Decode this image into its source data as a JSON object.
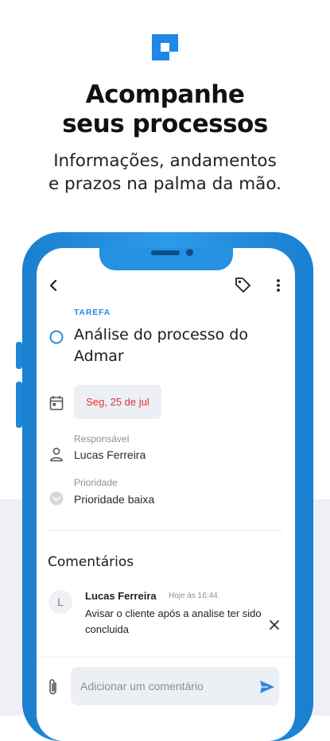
{
  "promo": {
    "headline_line1": "Acompanhe",
    "headline_line2": "seus processos",
    "subline_line1": "Informações, andamentos",
    "subline_line2": "e prazos na palma da mão.",
    "brand_color": "#1e88e5"
  },
  "app": {
    "header": {
      "back_icon": "chevron-left-icon",
      "tag_icon": "tag-icon",
      "more_icon": "more-vertical-icon"
    },
    "task": {
      "kind": "TAREFA",
      "title": "Análise do processo do Admar",
      "due_date": "Seg, 25 de jul",
      "due_date_color": "#e03232",
      "responsible_label": "Responsável",
      "responsible_value": "Lucas Ferreira",
      "priority_label": "Prioridade",
      "priority_value": "Prioridade baixa"
    },
    "comments": {
      "heading": "Comentários",
      "items": [
        {
          "avatar_initial": "L",
          "author": "Lucas Ferreira",
          "time": "Hoje às 16:44",
          "text": "Avisar o cliente após a analise ter sido concluida"
        }
      ]
    },
    "composer": {
      "placeholder": "Adicionar um comentário",
      "accent_color": "#2b8ae0"
    }
  }
}
